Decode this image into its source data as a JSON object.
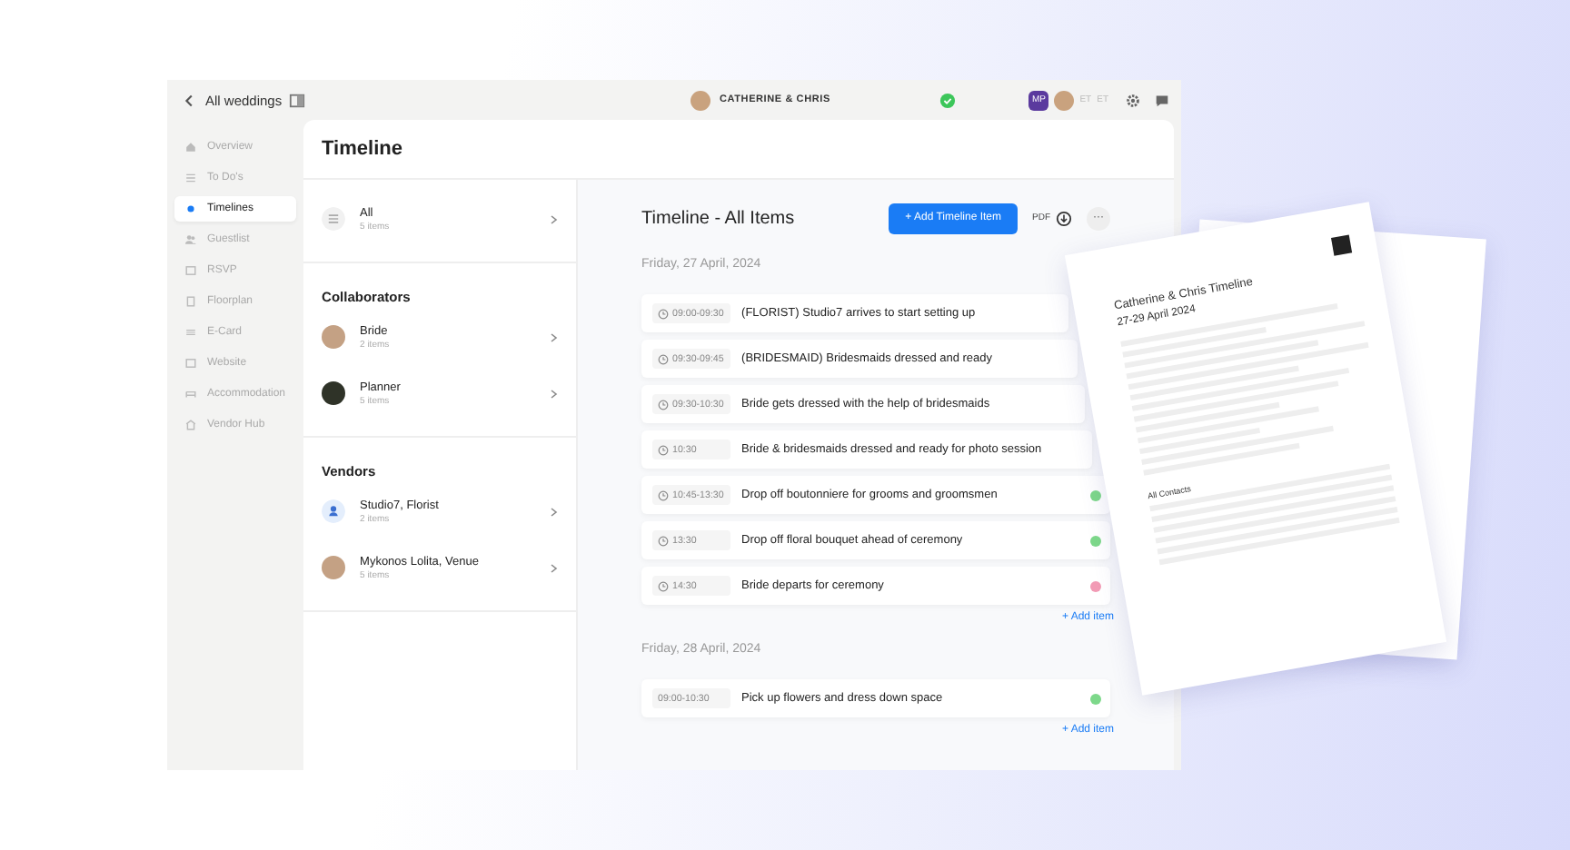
{
  "topbar": {
    "back_label": "All weddings",
    "couple": "CATHERINE & CHRIS",
    "avatars": [
      {
        "kind": "initials",
        "label": "MP"
      },
      {
        "kind": "photo"
      },
      {
        "kind": "initials-faint",
        "label": "ET"
      },
      {
        "kind": "initials-faint",
        "label": "ET"
      }
    ]
  },
  "sidebar": {
    "items": [
      {
        "label": "Overview",
        "selected": false
      },
      {
        "label": "To Do's",
        "selected": false
      },
      {
        "label": "Timelines",
        "selected": true
      },
      {
        "label": "Guestlist",
        "selected": false
      },
      {
        "label": "RSVP",
        "selected": false
      },
      {
        "label": "Floorplan",
        "selected": false
      },
      {
        "label": "E-Card",
        "selected": false
      },
      {
        "label": "Website",
        "selected": false
      },
      {
        "label": "Accommodation",
        "selected": false
      },
      {
        "label": "Vendor Hub",
        "selected": false
      }
    ]
  },
  "page_title": "Timeline",
  "groups": [
    {
      "items": [
        {
          "name": "All",
          "count": "5 items",
          "kind": "list"
        }
      ]
    },
    {
      "title": "Collaborators",
      "items": [
        {
          "name": "Bride",
          "count": "2 items",
          "kind": "photo"
        },
        {
          "name": "Planner",
          "count": "5 items",
          "kind": "photo-dark"
        }
      ]
    },
    {
      "title": "Vendors",
      "items": [
        {
          "name": "Studio7, Florist",
          "count": "2 items",
          "kind": "person"
        },
        {
          "name": "Mykonos Lolita, Venue",
          "count": "5 items",
          "kind": "photo"
        }
      ]
    }
  ],
  "timeline": {
    "title": "Timeline - All Items",
    "add_button": "+ Add Timeline Item",
    "pdf_label": "PDF",
    "more": "···",
    "days": [
      {
        "date": "Friday, 27 April, 2024",
        "add_label": "+ Add item",
        "items": [
          {
            "time": "09:00-09:30",
            "clock": true,
            "text": "(FLORIST) Studio7 arrives to start setting up"
          },
          {
            "time": "09:30-09:45",
            "clock": true,
            "text": "(BRIDESMAID) Bridesmaids dressed and ready"
          },
          {
            "time": "09:30-10:30",
            "clock": true,
            "text": "Bride gets dressed with the help of bridesmaids"
          },
          {
            "time": "10:30",
            "clock": true,
            "text": "Bride & bridesmaids dressed and ready for photo session"
          },
          {
            "time": "10:45-13:30",
            "clock": true,
            "text": "Drop off boutonniere for grooms and groomsmen",
            "color": "#7dd88a"
          },
          {
            "time": "13:30",
            "clock": true,
            "text": "Drop off floral bouquet ahead of ceremony",
            "color": "#7dd88a"
          },
          {
            "time": "14:30",
            "clock": true,
            "text": "Bride departs for ceremony",
            "color": "#f29bb5"
          }
        ]
      },
      {
        "date": "Friday, 28 April, 2024",
        "add_label": "+ Add item",
        "items": [
          {
            "time": "09:00-10:30",
            "clock": false,
            "text": "Pick up flowers and dress down space",
            "color": "#7dd88a"
          }
        ]
      }
    ]
  },
  "pdf_preview": {
    "title": "Catherine & Chris Timeline",
    "dates": "27-29 April 2024",
    "contacts_heading": "All Contacts"
  }
}
